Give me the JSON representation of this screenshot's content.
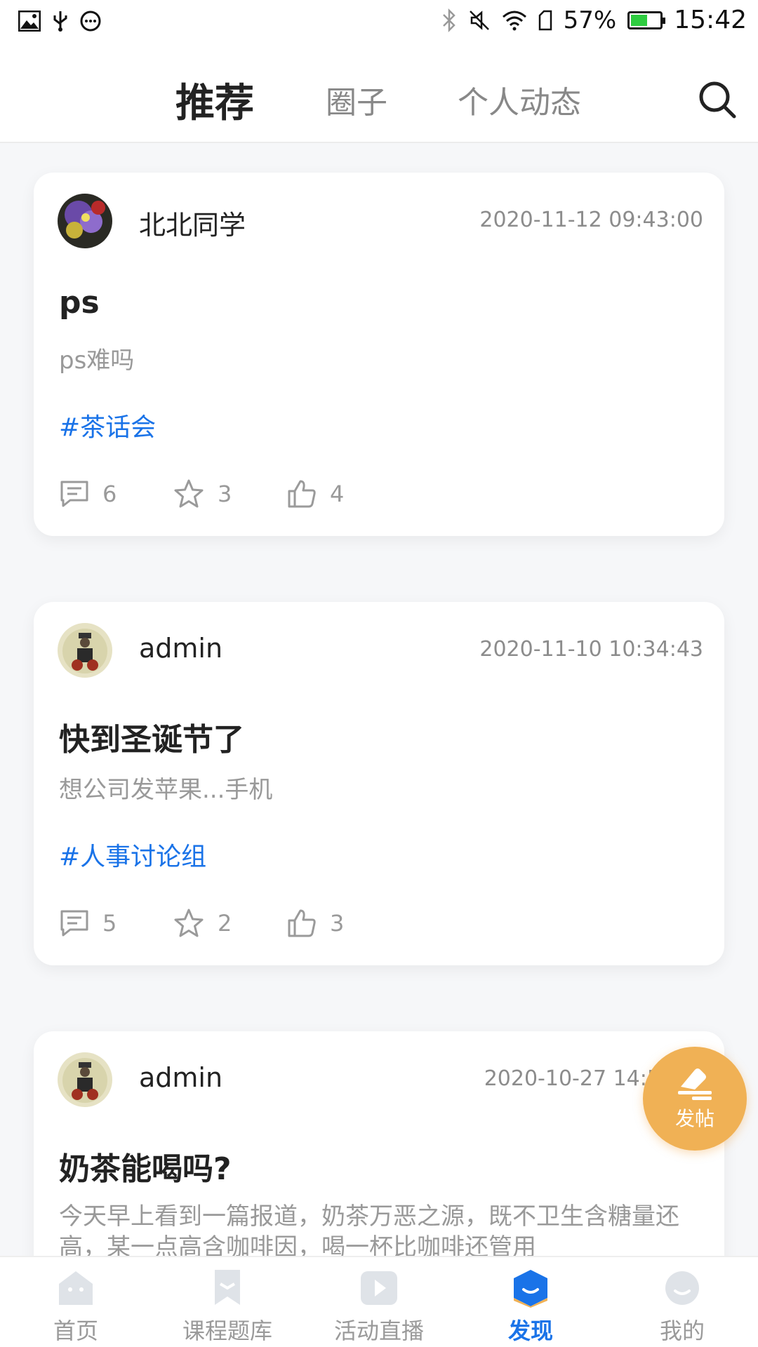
{
  "status_bar": {
    "battery": "57%",
    "battery_level": 0.57,
    "time": "15:42"
  },
  "header": {
    "tabs": [
      "推荐",
      "圈子",
      "个人动态"
    ],
    "active_tab": 0,
    "search_icon": "search-icon"
  },
  "posts": [
    {
      "user": "北北同学",
      "time": "2020-11-12 09:43:00",
      "title": "ps",
      "desc": "ps难吗",
      "topic": "#茶话会",
      "comments": "6",
      "stars": "3",
      "likes": "4"
    },
    {
      "user": "admin",
      "time": "2020-11-10 10:34:43",
      "title": "快到圣诞节了",
      "desc": "想公司发苹果...手机",
      "topic": "#人事讨论组",
      "comments": "5",
      "stars": "2",
      "likes": "3"
    },
    {
      "user": "admin",
      "time": "2020-10-27 14:56:??",
      "title": "奶茶能喝吗?",
      "desc": "今天早上看到一篇报道，奶茶万恶之源，既不卫生含糖量还高，某一点高含咖啡因，喝一杯比咖啡还管用"
    }
  ],
  "fab": {
    "label": "发帖",
    "icon": "edit-icon"
  },
  "bottom_nav": {
    "items": [
      "首页",
      "课程题库",
      "活动直播",
      "发现",
      "我的"
    ],
    "active": 3
  },
  "colors": {
    "accent": "#1a73e8",
    "fab": "#f0b155"
  }
}
